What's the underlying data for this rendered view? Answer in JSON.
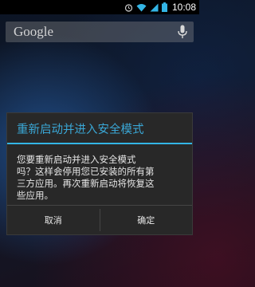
{
  "status_bar": {
    "time": "10:08",
    "icons": [
      "alarm-icon",
      "wifi-icon",
      "signal-icon",
      "battery-icon"
    ]
  },
  "search": {
    "placeholder": "Google",
    "icon": "mic-icon"
  },
  "dialog": {
    "title": "重新启动并进入安全模式",
    "message_lines": [
      "您要重新启动并进入安全模式",
      "吗？这样会停用您已安装的所有第",
      "三方应用。再次重新启动将恢复这",
      "些应用。"
    ],
    "cancel_label": "取消",
    "ok_label": "确定",
    "accent_color": "#33b5e5"
  }
}
